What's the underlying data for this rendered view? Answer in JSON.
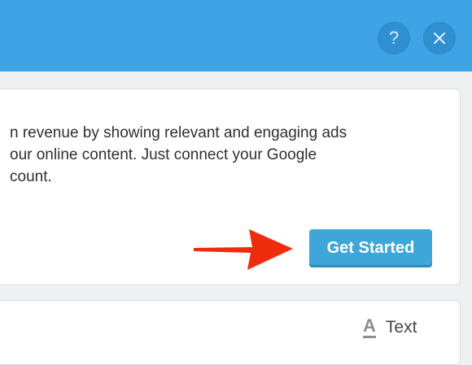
{
  "header": {
    "help_label": "?",
    "close_label": "close"
  },
  "card": {
    "description_lines": [
      "n revenue by showing relevant and engaging ads",
      "our online content. Just connect your Google",
      "count."
    ],
    "primary_button": "Get Started",
    "arrow_color": "#f02c0f"
  },
  "footer_card": {
    "text_icon_glyph": "A",
    "text_button_label": "Text"
  },
  "colors": {
    "header": "#3fa4e6",
    "header_button": "#2f8fd0",
    "primary_button": "#3ea6d8"
  }
}
